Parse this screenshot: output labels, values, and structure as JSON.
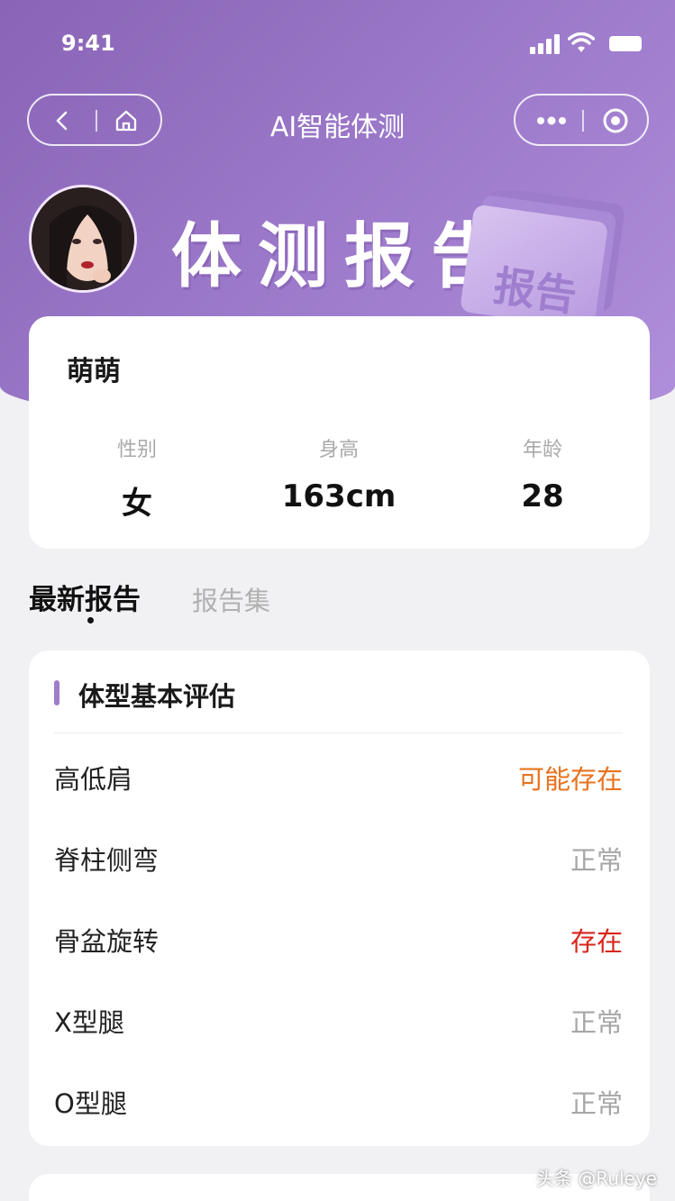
{
  "status_bar": {
    "time": "9:41"
  },
  "nav": {
    "title": "AI智能体测"
  },
  "hero": {
    "title": "体测报告",
    "badge_text": "报告"
  },
  "profile": {
    "name": "萌萌",
    "stats": [
      {
        "label": "性别",
        "value": "女"
      },
      {
        "label": "身高",
        "value": "163cm"
      },
      {
        "label": "年龄",
        "value": "28"
      }
    ]
  },
  "tabs": {
    "active": "最新报告",
    "inactive": "报告集"
  },
  "assessment": {
    "title": "体型基本评估",
    "rows": [
      {
        "label": "高低肩",
        "value": "可能存在",
        "color": "#e8731e"
      },
      {
        "label": "脊柱侧弯",
        "value": "正常",
        "color": "#a6a6a6"
      },
      {
        "label": "骨盆旋转",
        "value": "存在",
        "color": "#d9251c"
      },
      {
        "label": "X型腿",
        "value": "正常",
        "color": "#a6a6a6"
      },
      {
        "label": "O型腿",
        "value": "正常",
        "color": "#a6a6a6"
      }
    ]
  },
  "watermark": "头条 @Ruleye",
  "colors": {
    "accent": "#a07ccd",
    "header_start": "#8a64b6",
    "header_end": "#b08fdb"
  }
}
